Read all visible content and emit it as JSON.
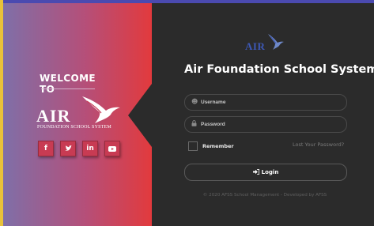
{
  "left_panel": {
    "welcome": "WELCOME TO",
    "logo": {
      "wordmark": "AIR",
      "subtitle": "FOUNDATION SCHOOL SYSTEM"
    },
    "social": [
      {
        "icon": "facebook-icon",
        "glyph": "f"
      },
      {
        "icon": "twitter-icon",
        "glyph": "✦"
      },
      {
        "icon": "linkedin-icon",
        "glyph": "in"
      },
      {
        "icon": "youtube-icon",
        "glyph": "▶"
      }
    ],
    "colors": {
      "gradient_start": "#7f6fa8",
      "gradient_end": "#e23a3d",
      "social_bg": "#c83b53"
    }
  },
  "right_panel": {
    "logo": {
      "wordmark": "AIR"
    },
    "title": "Air Foundation School System",
    "username": {
      "placeholder": "Username",
      "value": ""
    },
    "password": {
      "placeholder": "Password",
      "value": ""
    },
    "remember_label": "Remember",
    "lost_password": "Lost Your Password?",
    "login_label": "Login",
    "footer": "© 2020 AFSS School Management - Developed by AFSS",
    "colors": {
      "logo_blue": "#3d58b6",
      "panel_bg": "#2b2b2b"
    }
  }
}
